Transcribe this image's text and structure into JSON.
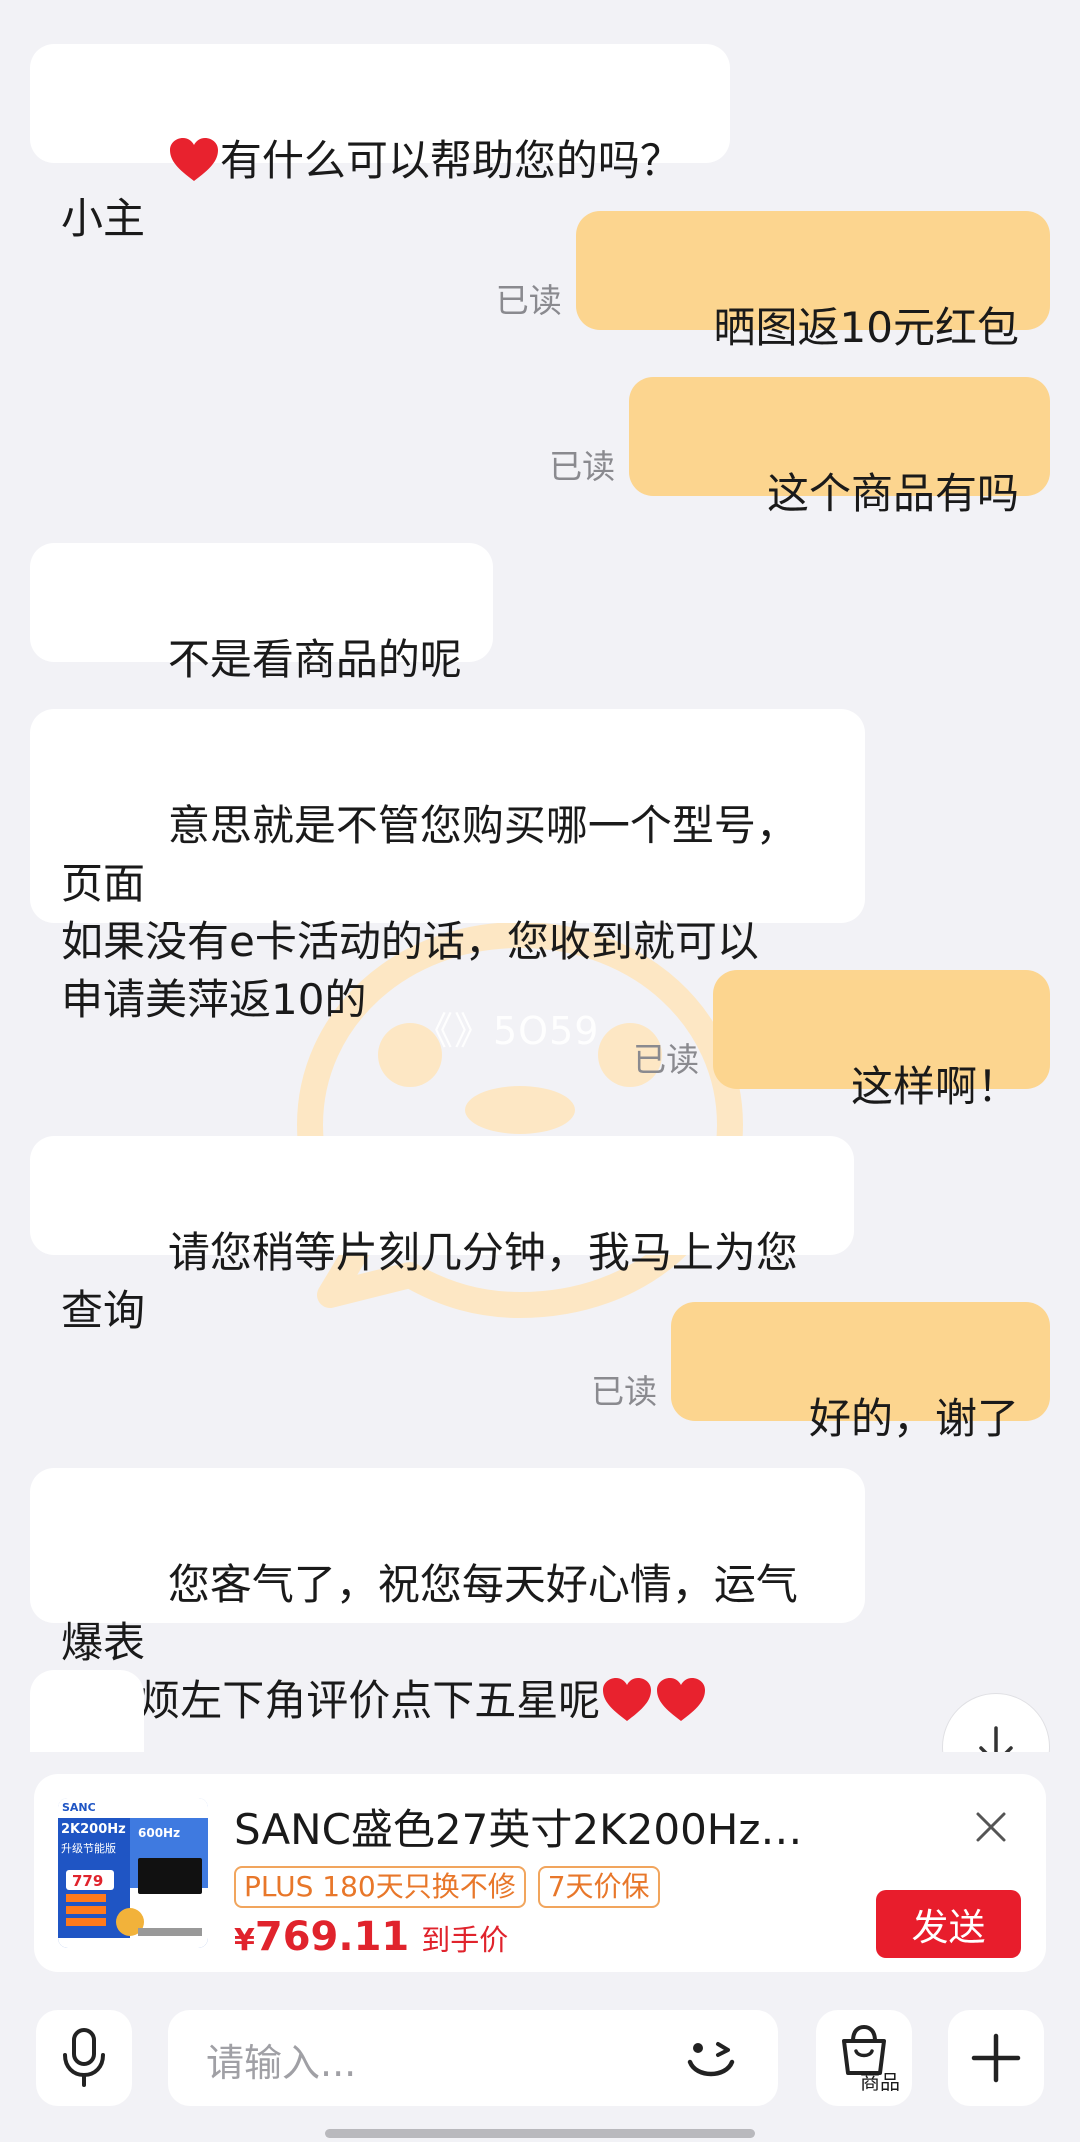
{
  "watermark_text": "《》5O59",
  "messages": [
    {
      "side": "in",
      "text": "有什么可以帮助您的吗？小主",
      "heart_prefix": true
    },
    {
      "side": "out",
      "text": "晒图返10元红包",
      "status": "已读"
    },
    {
      "side": "out",
      "text": "这个商品有吗",
      "status": "已读"
    },
    {
      "side": "in",
      "text": "不是看商品的呢"
    },
    {
      "side": "in",
      "text": "意思就是不管您购买哪一个型号，页面\n如果没有e卡活动的话，您收到就可以\n申请美萍返10的"
    },
    {
      "side": "out",
      "text": "这样啊！",
      "status": "已读"
    },
    {
      "side": "in",
      "text": "请您稍等片刻几分钟，我马上为您查询"
    },
    {
      "side": "out",
      "text": "好的，谢了",
      "status": "已读"
    },
    {
      "side": "in",
      "text": "您客气了，祝您每天好心情，运气爆表\n~麻烦左下角评价点下五星呢",
      "heart_suffix_count": 2
    },
    {
      "side": "in",
      "text": "",
      "heart_only": true
    }
  ],
  "product": {
    "title": "SANC盛色27英寸2K200Hz…",
    "tags": [
      "PLUS 180天只换不修",
      "7天价保"
    ],
    "currency": "¥",
    "price": "769.11",
    "price_suffix": "到手价",
    "send_label": "发送",
    "thumb": {
      "brand": "SANC",
      "headline": "2K200Hz",
      "sub": "升级节能版",
      "promo_price": "779",
      "badge": "600Hz"
    }
  },
  "input": {
    "placeholder": "请输入...",
    "goods_label": "商品"
  },
  "colors": {
    "background": "#f2f2f6",
    "incoming_bubble": "#ffffff",
    "outgoing_bubble": "#fcd58f",
    "accent_red": "#e81d2c",
    "price_red": "#e0232c",
    "tag_orange": "#e8772a"
  },
  "icons": [
    "heart-icon",
    "scroll-down-icon",
    "close-icon",
    "microphone-icon",
    "emoji-icon",
    "shopping-bag-icon",
    "plus-icon"
  ]
}
